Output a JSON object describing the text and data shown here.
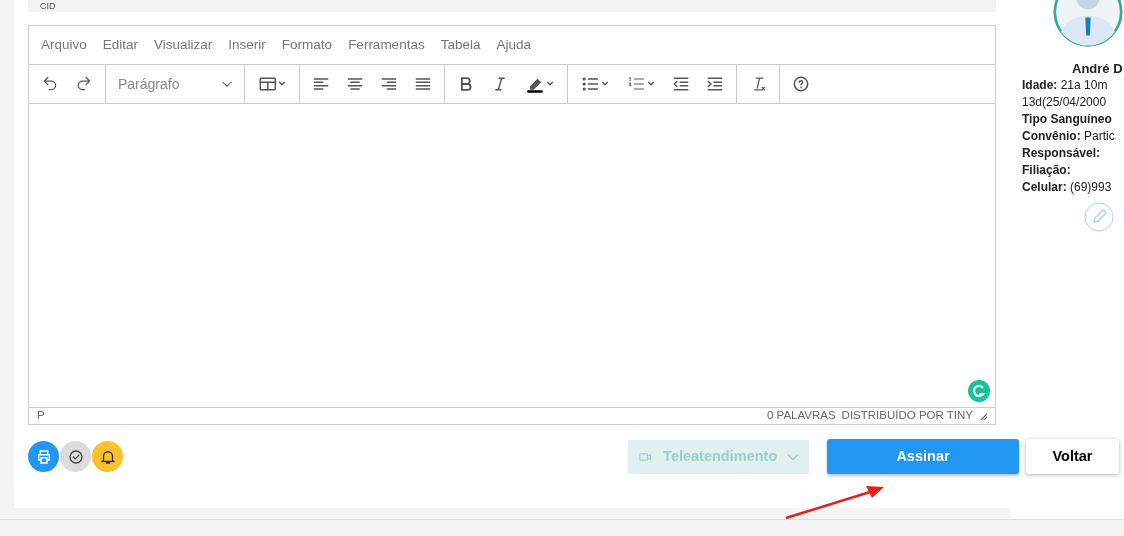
{
  "cid_field": {
    "label": "CID"
  },
  "editor": {
    "menu": [
      "Arquivo",
      "Editar",
      "Visualizar",
      "Inserir",
      "Formato",
      "Ferramentas",
      "Tabela",
      "Ajuda"
    ],
    "block_format": "Parágrafo",
    "status_path": "P",
    "word_count": "0 PALAVRAS",
    "branding": "DISTRIBUÍDO POR TINY"
  },
  "actions": {
    "round_buttons": [
      {
        "kind": "print",
        "color": "#2196f3"
      },
      {
        "kind": "check",
        "color": "#dcdcdc"
      },
      {
        "kind": "bell",
        "color": "#fbc02d"
      }
    ],
    "teleconsult": {
      "label": "Teleatendimento",
      "disabled": true
    },
    "sign": "Assinar",
    "back": "Voltar"
  },
  "patient": {
    "name": "André D",
    "fields": [
      {
        "label": "Idade:",
        "value": "21a 10m"
      },
      {
        "value": "13d(25/04/2000"
      },
      {
        "label": "Tipo Sanguíneo"
      },
      {
        "label": "Convênio:",
        "value": "Partic"
      },
      {
        "label": "Responsável:"
      },
      {
        "label": "Filiação:"
      },
      {
        "label": "Celular:",
        "value": "(69)993"
      }
    ]
  }
}
